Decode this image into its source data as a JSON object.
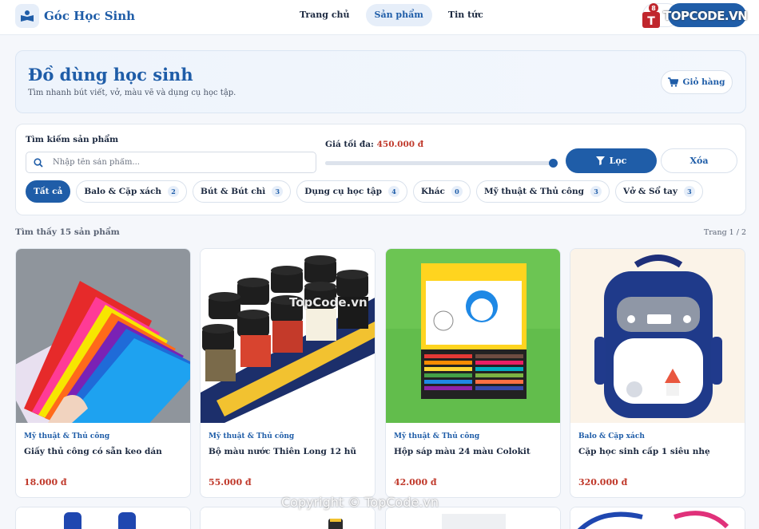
{
  "header": {
    "brand": "Góc Học Sinh",
    "nav": [
      "Trang chủ",
      "Sản phẩm",
      "Tin tức"
    ]
  },
  "watermark": {
    "logo_text": "TOPCODE.VN",
    "center": "TopCode.vn",
    "bottom": "Copyright © TopCode.vn"
  },
  "hero": {
    "title": "Đồ dùng học sinh",
    "subtitle": "Tìm nhanh bút viết, vở, màu vẽ và dụng cụ học tập.",
    "cart_label": "Giỏ hàng"
  },
  "filter": {
    "search_label": "Tìm kiếm sản phẩm",
    "search_placeholder": "Nhập tên sản phẩm...",
    "search_value": "",
    "price_label": "Giá tối đa:",
    "price_value": "450.000 đ",
    "price_slider_fraction": 1.0,
    "filter_button": "Lọc",
    "clear_button": "Xóa",
    "chips": [
      {
        "label": "Tất cả",
        "count": ""
      },
      {
        "label": "Balo & Cặp xách",
        "count": "2"
      },
      {
        "label": "Bút & Bút chì",
        "count": "3"
      },
      {
        "label": "Dụng cụ học tập",
        "count": "4"
      },
      {
        "label": "Khác",
        "count": "0"
      },
      {
        "label": "Mỹ thuật & Thủ công",
        "count": "3"
      },
      {
        "label": "Vở & Sổ tay",
        "count": "3"
      }
    ]
  },
  "results": {
    "count_text": "Tìm thấy 15 sản phẩm",
    "page_text": "Trang 1 / 2"
  },
  "products": [
    {
      "category": "Mỹ thuật & Thủ công",
      "name": "Giấy thủ công có sẵn keo dán",
      "price": "18.000 đ"
    },
    {
      "category": "Mỹ thuật & Thủ công",
      "name": "Bộ màu nước Thiên Long 12 hũ",
      "price": "55.000 đ"
    },
    {
      "category": "Mỹ thuật & Thủ công",
      "name": "Hộp sáp màu 24 màu Colokit",
      "price": "42.000 đ"
    },
    {
      "category": "Balo & Cặp xách",
      "name": "Cặp học sinh cấp 1 siêu nhẹ",
      "price": "320.000 đ"
    }
  ],
  "colors": {
    "primary": "#1f5da8",
    "price": "#c0392b",
    "background": "#f5f7fb"
  }
}
